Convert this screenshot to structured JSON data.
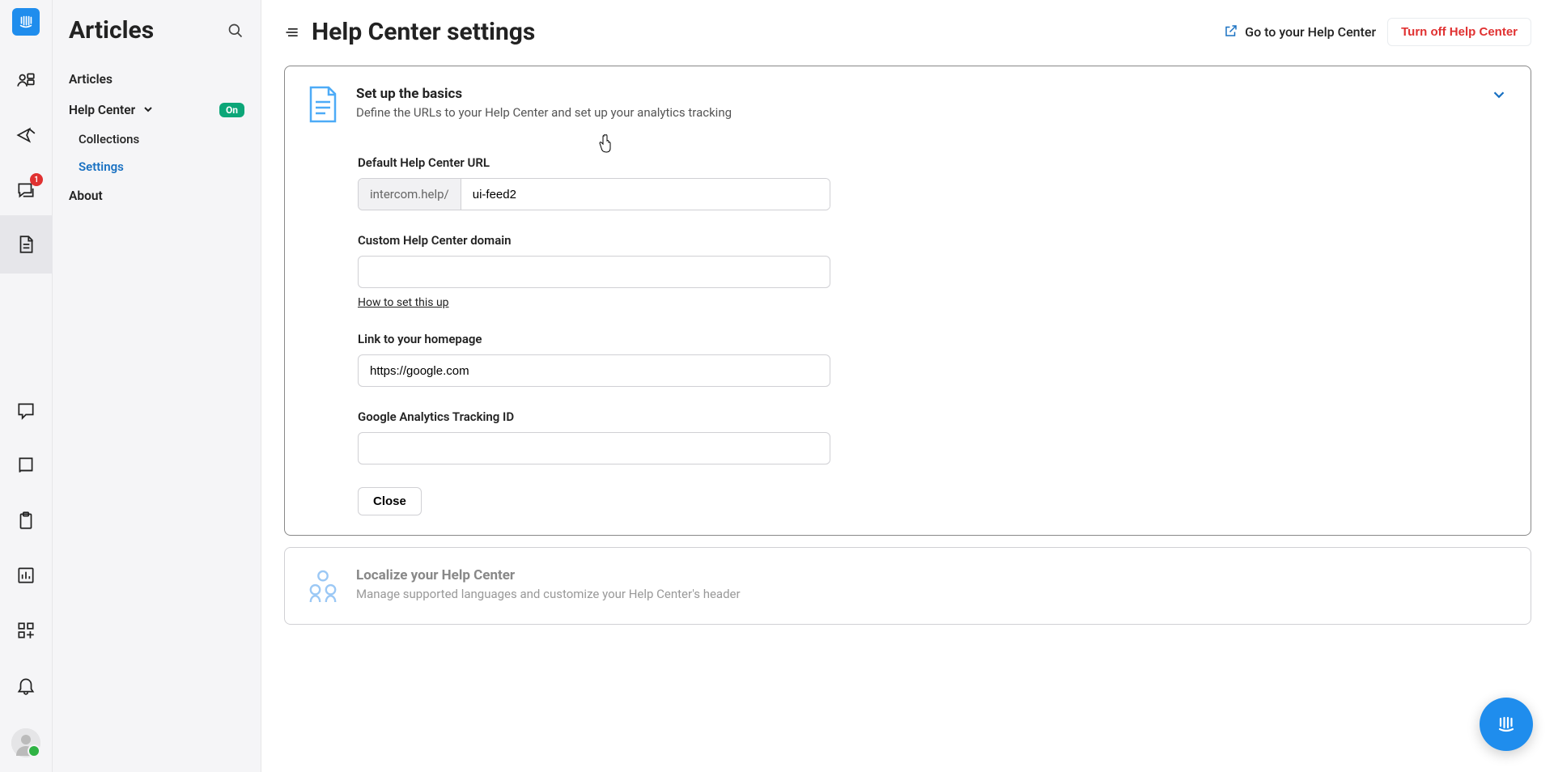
{
  "rail": {
    "badge_conversations": "1"
  },
  "sidebar": {
    "title": "Articles",
    "items": {
      "articles": "Articles",
      "help_center": "Help Center",
      "help_center_badge": "On",
      "collections": "Collections",
      "settings": "Settings",
      "about": "About"
    }
  },
  "header": {
    "title": "Help Center settings",
    "go_link": "Go to your Help Center",
    "turn_off": "Turn off Help Center"
  },
  "cards": {
    "basics": {
      "title": "Set up the basics",
      "sub": "Define the URLs to your Help Center and set up your analytics tracking",
      "url_label": "Default Help Center URL",
      "url_prefix": "intercom.help/",
      "url_value": "ui-feed2",
      "domain_label": "Custom Help Center domain",
      "domain_value": "",
      "domain_help": "How to set this up",
      "homepage_label": "Link to your homepage",
      "homepage_value": "https://google.com",
      "ga_label": "Google Analytics Tracking ID",
      "ga_value": "",
      "close": "Close"
    },
    "localize": {
      "title": "Localize your Help Center",
      "sub": "Manage supported languages and customize your Help Center's header"
    }
  }
}
